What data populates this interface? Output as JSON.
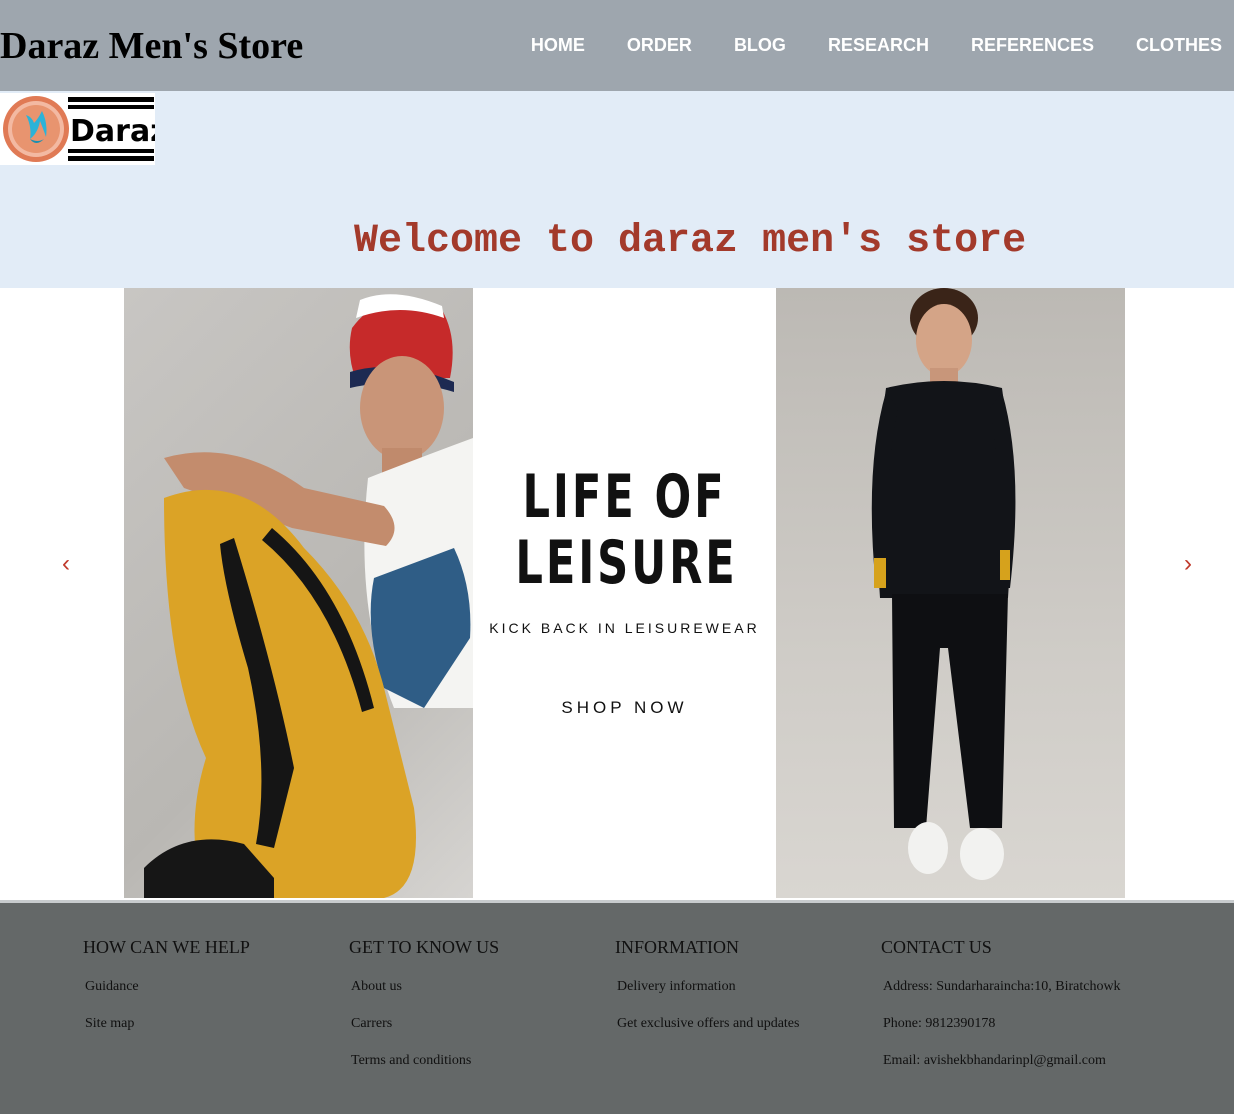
{
  "header": {
    "title": "Daraz Men's Store",
    "nav": [
      "HOME",
      "ORDER",
      "BLOG",
      "RESEARCH",
      "REFERENCES",
      "CLOTHES"
    ]
  },
  "banner": {
    "logo_text": "Daraz",
    "welcome": "Welcome to daraz men's store"
  },
  "slider": {
    "prev_arrow": "‹",
    "next_arrow": "›",
    "promo_title": "LIFE  OF\nLEISURE",
    "promo_subtitle": "KICK BACK IN LEISUREWEAR",
    "promo_cta": "SHOP NOW"
  },
  "footer": {
    "columns": [
      {
        "heading": "HOW CAN WE HELP",
        "links": [
          "Guidance",
          "Site map"
        ]
      },
      {
        "heading": "GET TO KNOW US",
        "links": [
          "About us",
          "Carrers",
          "Terms and conditions"
        ]
      },
      {
        "heading": "INFORMATION",
        "links": [
          "Delivery information",
          "Get exclusive offers and updates"
        ]
      },
      {
        "heading": "CONTACT US",
        "lines": [
          "Address: Sundarharaincha:10, Biratchowk",
          "Phone: 9812390178",
          "Email: avishekbhandarinpl@gmail.com"
        ]
      }
    ]
  },
  "colors": {
    "header_bg": "#9ea6ae",
    "banner_bg": "#e2ecf7",
    "welcome_text": "#a33a2b",
    "footer_bg": "#646868",
    "arrow": "#c0392b"
  }
}
